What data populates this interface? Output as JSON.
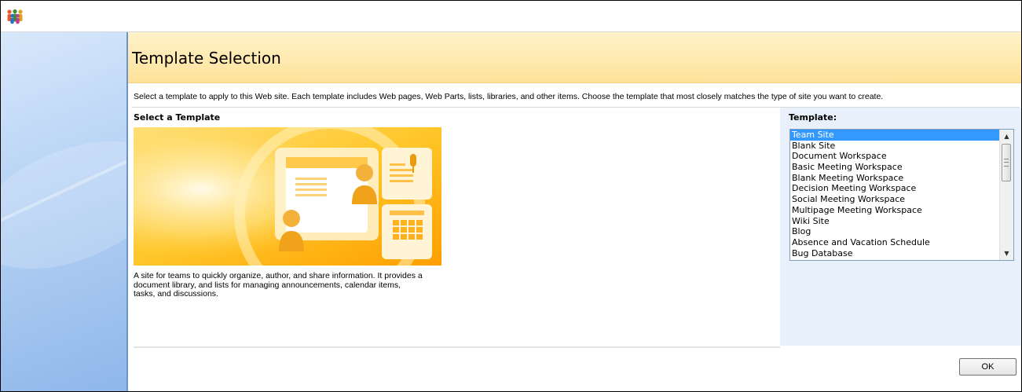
{
  "page": {
    "title": "Template Selection",
    "description": "Select a template to apply to this Web site. Each template includes Web pages, Web Parts, lists, libraries, and other items. Choose the template that most closely matches the type of site you want to create."
  },
  "left_column": {
    "heading": "Select a Template",
    "preview_description": "A site for teams to quickly organize, author, and share information. It provides a document library, and lists for managing announcements, calendar items, tasks, and discussions."
  },
  "template_picker": {
    "label": "Template:",
    "selected": "Team Site",
    "options": [
      "Team Site",
      "Blank Site",
      "Document Workspace",
      "Basic Meeting Workspace",
      "Blank Meeting Workspace",
      "Decision Meeting Workspace",
      "Social Meeting Workspace",
      "Multipage Meeting Workspace",
      "Wiki Site",
      "Blog",
      "Absence and Vacation Schedule",
      "Bug Database"
    ]
  },
  "buttons": {
    "ok_label": "OK"
  },
  "icons": {
    "logo": "sharepoint-people-icon",
    "scroll_up": "scroll-up-arrow-icon",
    "scroll_down": "scroll-down-arrow-icon"
  },
  "colors": {
    "header_band": "#fee29a",
    "left_pane": "#bcd6f6",
    "selection": "#3399ff",
    "right_panel": "#e8f0fb"
  }
}
